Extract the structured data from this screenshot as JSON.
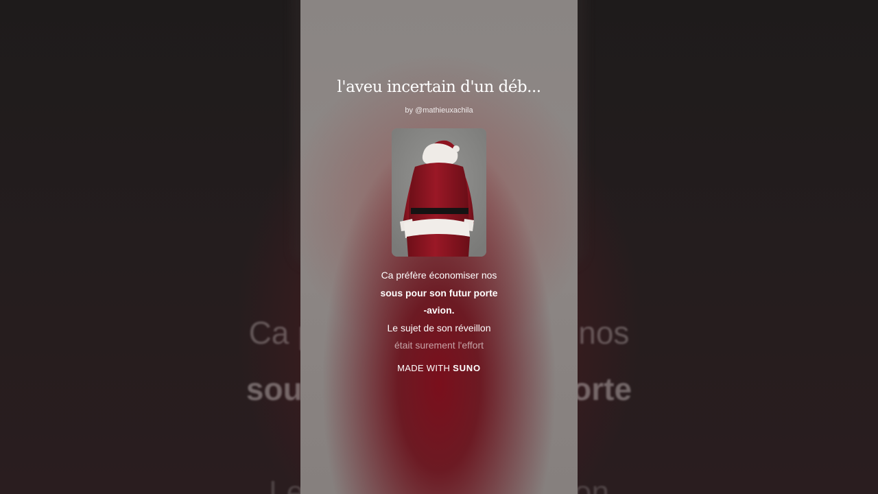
{
  "song": {
    "title": "l'aveu incertain d'un déb...",
    "byline": "by @mathieuxachila"
  },
  "cover_art": {
    "icon": "santa-claus-back-view-image",
    "colors": {
      "coat": "#8e1420",
      "fur": "#f2efec",
      "belt": "#141212",
      "backdrop": "#858583"
    }
  },
  "lyrics": {
    "line1": "Ca préfère économiser nos",
    "line2": "sous pour son futur porte",
    "line3": "-avion.",
    "line4": "Le sujet de son réveillon",
    "line5": "était surement l'effort"
  },
  "footer": {
    "made_with": "MADE WITH",
    "brand": "SUNO"
  },
  "background_lyrics": {
    "line1": "Ca préfère économiser nos",
    "line2": "sous pour son futur porte",
    "line3": "Le sujet de son réveillon"
  }
}
